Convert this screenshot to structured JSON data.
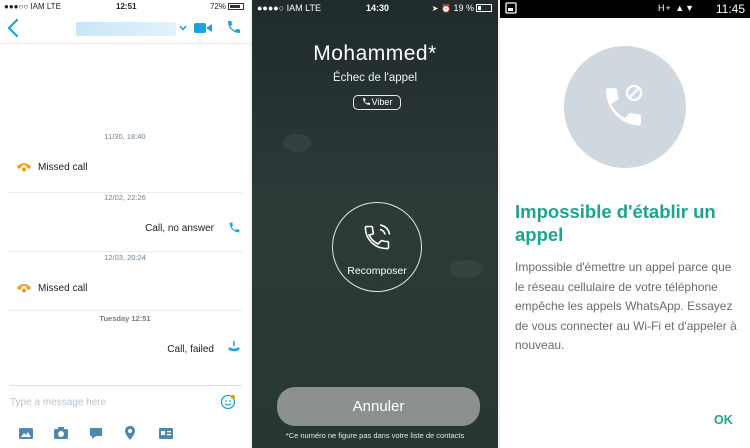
{
  "skype": {
    "status": {
      "carrier": "●●●○○ IAM  LTE",
      "time": "12:51",
      "battery": "72%"
    },
    "header": {
      "contact_name": ""
    },
    "messages": [
      {
        "date": "11/30, 18:40",
        "text": "Missed call",
        "side": "left"
      },
      {
        "date": "12/02, 22:26",
        "text": "Call, no answer",
        "side": "right"
      },
      {
        "date": "12/03, 20:24",
        "text": "Missed call",
        "side": "left"
      },
      {
        "date": "Tuesday 12:51",
        "text": "Call, failed",
        "side": "right"
      }
    ],
    "input_placeholder": "Type a message here",
    "colors": {
      "accent": "#1aa3e0",
      "missed": "#f39c12"
    }
  },
  "viber": {
    "status": {
      "carrier": "●●●●○ IAM  LTE",
      "time": "14:30",
      "battery": "19 %"
    },
    "contact_name": "Mohammed*",
    "call_status": "Échec de l'appel",
    "badge": "Viber",
    "redial_label": "Recomposer",
    "cancel_label": "Annuler",
    "footer_note": "*Ce numéro ne figure pas dans votre liste de contacts"
  },
  "whatsapp": {
    "status": {
      "time": "11:45",
      "indicators": "H+ ▲▼"
    },
    "title": "Impossible d'établir un appel",
    "body": "Impossible d'émettre un appel parce que le réseau cellulaire de votre téléphone empêche les appels WhatsApp. Essayez de vous connecter au Wi-Fi et d'appeler à nouveau.",
    "ok_label": "OK",
    "colors": {
      "accent": "#1aa68e",
      "circle": "#cfd8de"
    }
  }
}
